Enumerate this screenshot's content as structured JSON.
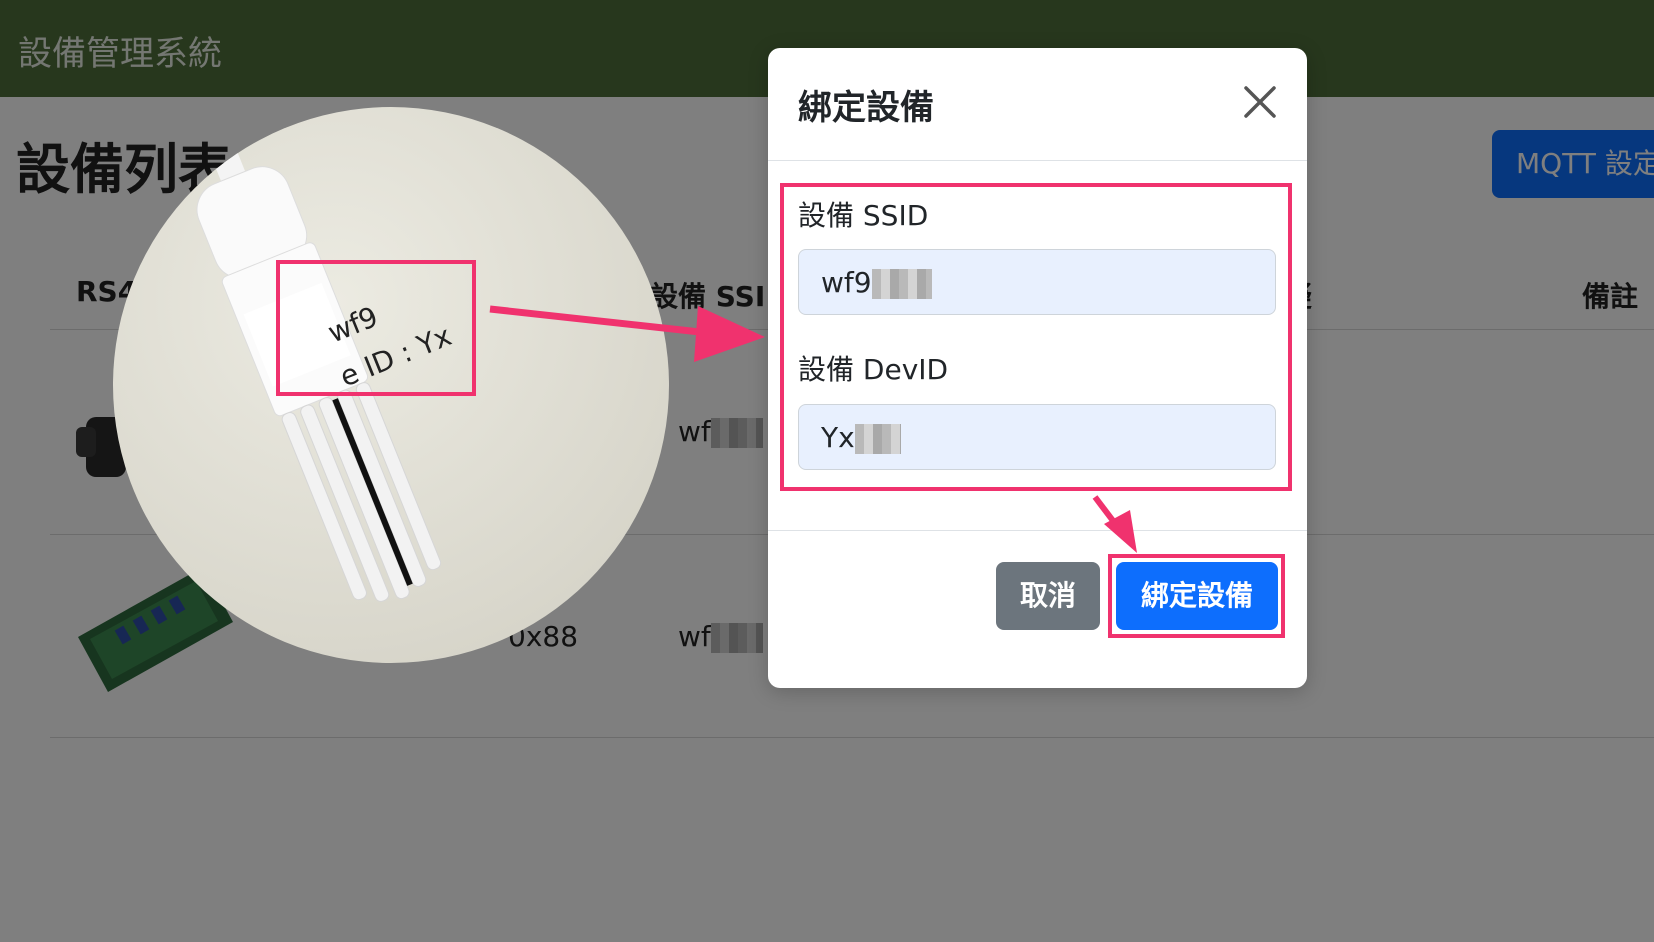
{
  "navbar": {
    "brand": "設備管理系統"
  },
  "page": {
    "title": "設備列表",
    "mqtt_button": "MQTT 設定"
  },
  "table": {
    "headers": {
      "col1": "RS4",
      "ssid": "設備 SSI",
      "col_partial": "疑",
      "remark": "備註"
    },
    "rows": [
      {
        "image": "sensor-device-image",
        "ssid_prefix": "wf"
      },
      {
        "image": "relay-board-image",
        "address": "0x88",
        "ssid_prefix": "wf"
      }
    ]
  },
  "zoom": {
    "label_line1": "wf9",
    "label_line2": "e ID : Yx"
  },
  "modal": {
    "title": "綁定設備",
    "ssid_label": "設備 SSID",
    "ssid_value": "wf9",
    "devid_label": "設備 DevID",
    "devid_value": "Yx",
    "cancel": "取消",
    "submit": "綁定設備"
  },
  "colors": {
    "navbar": "#4f6f3a",
    "primary": "#0d6efd",
    "secondary": "#6c757d",
    "highlight": "#f0326e"
  },
  "icons": {
    "close": "close-icon"
  }
}
